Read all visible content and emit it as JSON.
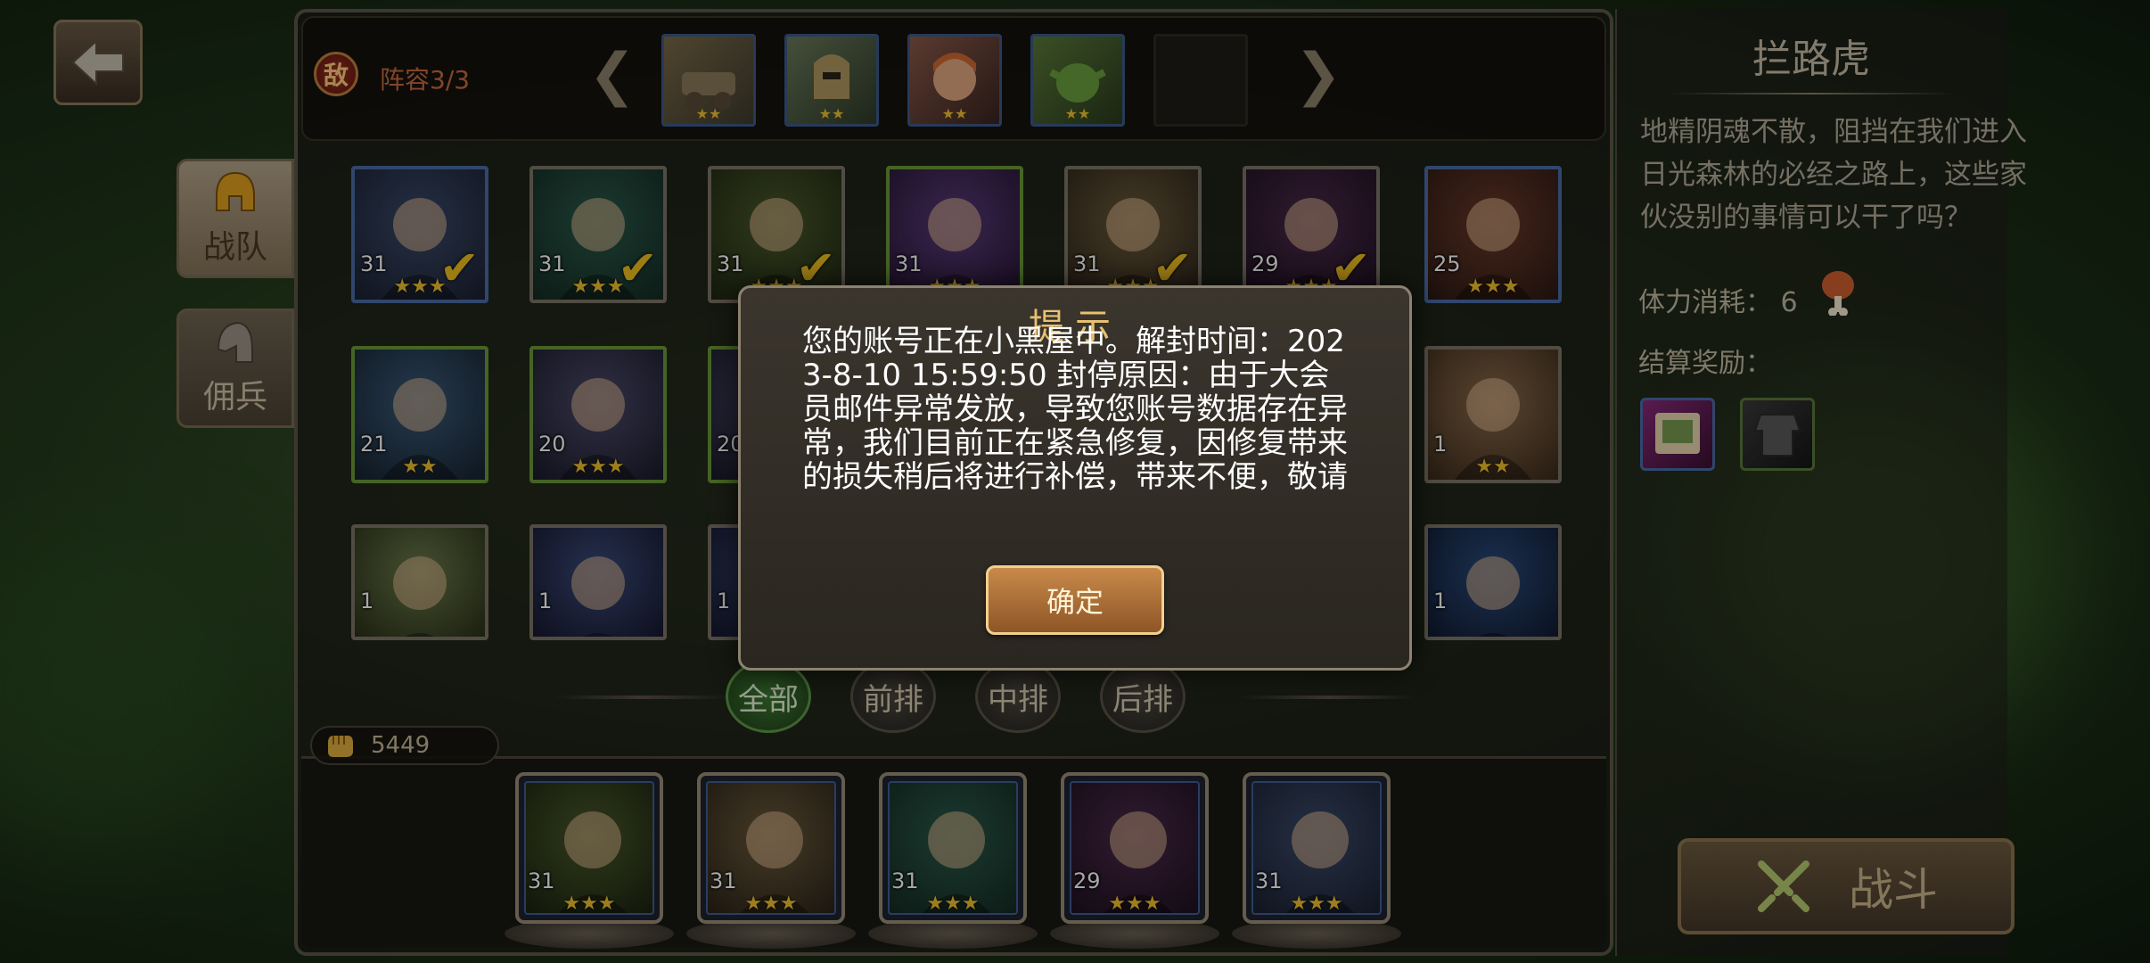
{
  "nav": {
    "back_icon": "back-arrow-icon",
    "tabs": [
      {
        "label": "战队",
        "icon": "golden-helmet-icon",
        "active": true
      },
      {
        "label": "佣兵",
        "icon": "gray-helmet-icon",
        "active": false
      }
    ]
  },
  "enemy_bar": {
    "badge": "敌",
    "lineup_label": "阵容3/3",
    "enemies": [
      {
        "name": "cannon-enemy",
        "stars": "★★"
      },
      {
        "name": "armored-knight-enemy",
        "stars": "★★"
      },
      {
        "name": "fox-girl-enemy",
        "stars": "★★"
      },
      {
        "name": "goblin-enemy",
        "stars": "★★"
      }
    ]
  },
  "heroes": [
    {
      "level": "31",
      "stars": "★★★",
      "checked": true
    },
    {
      "level": "31",
      "stars": "★★★",
      "checked": true
    },
    {
      "level": "31",
      "stars": "★★★",
      "checked": true
    },
    {
      "level": "31",
      "stars": "★★★",
      "checked": false
    },
    {
      "level": "31",
      "stars": "★★★",
      "checked": true
    },
    {
      "level": "29",
      "stars": "★★★",
      "checked": true
    },
    {
      "level": "25",
      "stars": "★★★",
      "checked": false
    },
    {
      "level": "21",
      "stars": "★★",
      "checked": false
    },
    {
      "level": "20",
      "stars": "★★★",
      "checked": false
    },
    {
      "level": "20",
      "stars": "",
      "checked": false
    },
    {
      "level": "1",
      "stars": "★★",
      "checked": false
    },
    {
      "level": "1",
      "stars": "",
      "checked": false
    },
    {
      "level": "1",
      "stars": "",
      "checked": false
    },
    {
      "level": "1",
      "stars": "",
      "checked": false
    },
    {
      "level": "1",
      "stars": "",
      "checked": false
    }
  ],
  "filters": [
    {
      "label": "全部",
      "active": true
    },
    {
      "label": "前排",
      "active": false
    },
    {
      "label": "中排",
      "active": false
    },
    {
      "label": "后排",
      "active": false
    }
  ],
  "power": {
    "icon": "fist-icon",
    "value": "5449"
  },
  "team": [
    {
      "level": "31",
      "stars": "★★★"
    },
    {
      "level": "31",
      "stars": "★★★"
    },
    {
      "level": "31",
      "stars": "★★★"
    },
    {
      "level": "29",
      "stars": "★★★"
    },
    {
      "level": "31",
      "stars": "★★★"
    }
  ],
  "stage": {
    "title": "拦路虎",
    "description": "地精阴魂不散，阻挡在我们进入日光森林的必经之路上，这些家伙没别的事情可以干了吗？",
    "stamina_label": "体力消耗：",
    "stamina_value": "6",
    "reward_label": "结算奖励：",
    "fight_label": "战斗"
  },
  "dialog": {
    "title": "提示",
    "message": "您的账号正在小黑屋中。解封时间：2023-8-10 15:59:50 封停原因：由于大会员邮件异常发放，导致您账号数据存在异常，我们目前正在紧急修复，因修复带来的损失稍后将进行补偿，带来不便，敬请",
    "confirm": "确定"
  },
  "colors": {
    "star": "#f2c230",
    "check": "#f0c020",
    "dialog_title": "#e8c070",
    "enemy_label": "#c86a40"
  }
}
